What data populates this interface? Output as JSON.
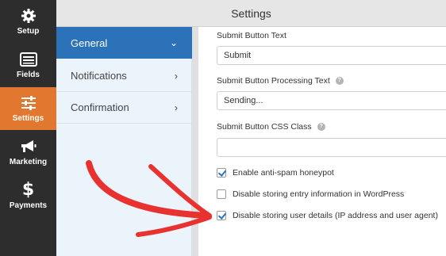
{
  "rail": {
    "items": [
      {
        "label": "Setup",
        "icon": "gear-icon"
      },
      {
        "label": "Fields",
        "icon": "list-icon"
      },
      {
        "label": "Settings",
        "icon": "sliders-icon",
        "active": true
      },
      {
        "label": "Marketing",
        "icon": "megaphone-icon"
      },
      {
        "label": "Payments",
        "icon": "dollar-icon"
      }
    ]
  },
  "header": {
    "title": "Settings"
  },
  "subnav": {
    "items": [
      {
        "label": "General",
        "chevron": "⌄",
        "active": true
      },
      {
        "label": "Notifications",
        "chevron": "›"
      },
      {
        "label": "Confirmation",
        "chevron": "›"
      }
    ]
  },
  "form": {
    "submit_text_label": "Submit Button Text",
    "submit_text_value": "Submit",
    "processing_label": "Submit Button Processing Text",
    "processing_value": "Sending...",
    "css_class_label": "Submit Button CSS Class",
    "css_class_value": "",
    "help_glyph": "?",
    "checkboxes": [
      {
        "label": "Enable anti-spam honeypot",
        "checked": true
      },
      {
        "label": "Disable storing entry information in WordPress",
        "checked": false
      },
      {
        "label": "Disable storing user details (IP address and user agent)",
        "checked": true
      }
    ]
  },
  "colors": {
    "accent": "#e27730",
    "active_nav": "#2c72b8",
    "arrow": "#e8322f"
  }
}
